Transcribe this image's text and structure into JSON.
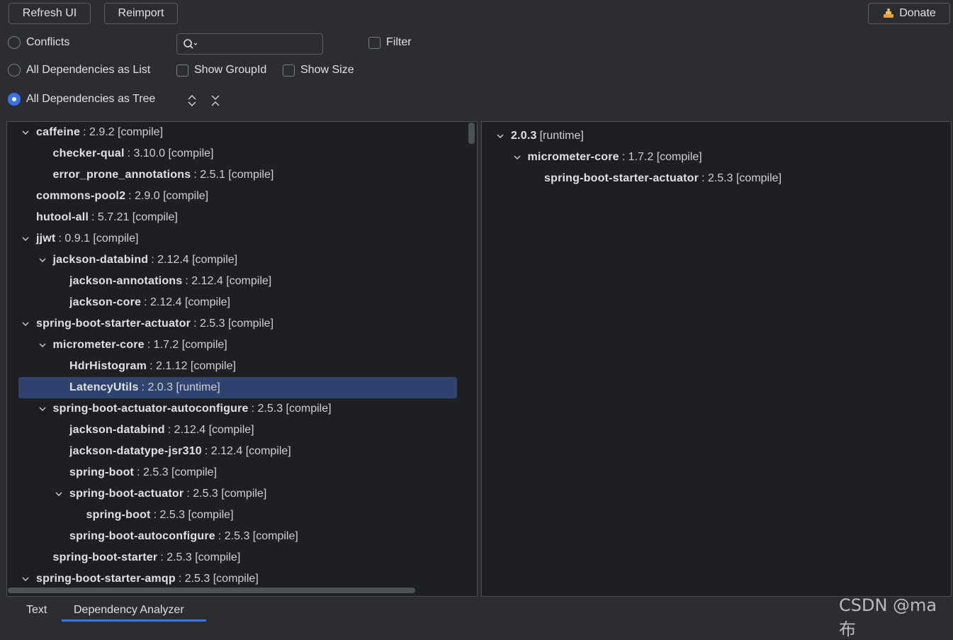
{
  "toolbar": {
    "refresh_label": "Refresh UI",
    "reimport_label": "Reimport",
    "donate_label": "Donate"
  },
  "options": {
    "conflicts_label": "Conflicts",
    "list_label": "All Dependencies as List",
    "tree_label": "All Dependencies as Tree",
    "selected_mode": "tree",
    "filter_label": "Filter",
    "show_groupid_label": "Show GroupId",
    "show_size_label": "Show Size",
    "search_value": "",
    "search_placeholder": ""
  },
  "tree": [
    {
      "name": "caffeine",
      "meta": ": 2.9.2 [compile]",
      "depth": 0,
      "expanded": true
    },
    {
      "name": "checker-qual",
      "meta": ": 3.10.0 [compile]",
      "depth": 1,
      "expanded": null
    },
    {
      "name": "error_prone_annotations",
      "meta": ": 2.5.1 [compile]",
      "depth": 1,
      "expanded": null
    },
    {
      "name": "commons-pool2",
      "meta": ": 2.9.0 [compile]",
      "depth": 0,
      "expanded": null
    },
    {
      "name": "hutool-all",
      "meta": ": 5.7.21 [compile]",
      "depth": 0,
      "expanded": null
    },
    {
      "name": "jjwt",
      "meta": ": 0.9.1 [compile]",
      "depth": 0,
      "expanded": true
    },
    {
      "name": "jackson-databind",
      "meta": ": 2.12.4 [compile]",
      "depth": 1,
      "expanded": true
    },
    {
      "name": "jackson-annotations",
      "meta": ": 2.12.4 [compile]",
      "depth": 2,
      "expanded": null
    },
    {
      "name": "jackson-core",
      "meta": ": 2.12.4 [compile]",
      "depth": 2,
      "expanded": null
    },
    {
      "name": "spring-boot-starter-actuator",
      "meta": ": 2.5.3 [compile]",
      "depth": 0,
      "expanded": true
    },
    {
      "name": "micrometer-core",
      "meta": ": 1.7.2 [compile]",
      "depth": 1,
      "expanded": true
    },
    {
      "name": "HdrHistogram",
      "meta": ": 2.1.12 [compile]",
      "depth": 2,
      "expanded": null
    },
    {
      "name": "LatencyUtils",
      "meta": ": 2.0.3 [runtime]",
      "depth": 2,
      "expanded": null,
      "selected": true
    },
    {
      "name": "spring-boot-actuator-autoconfigure",
      "meta": ": 2.5.3 [compile]",
      "depth": 1,
      "expanded": true
    },
    {
      "name": "jackson-databind",
      "meta": ": 2.12.4 [compile]",
      "depth": 2,
      "expanded": null
    },
    {
      "name": "jackson-datatype-jsr310",
      "meta": ": 2.12.4 [compile]",
      "depth": 2,
      "expanded": null
    },
    {
      "name": "spring-boot",
      "meta": ": 2.5.3 [compile]",
      "depth": 2,
      "expanded": null
    },
    {
      "name": "spring-boot-actuator",
      "meta": ": 2.5.3 [compile]",
      "depth": 2,
      "expanded": true
    },
    {
      "name": "spring-boot",
      "meta": ": 2.5.3 [compile]",
      "depth": 3,
      "expanded": null
    },
    {
      "name": "spring-boot-autoconfigure",
      "meta": ": 2.5.3 [compile]",
      "depth": 2,
      "expanded": null
    },
    {
      "name": "spring-boot-starter",
      "meta": ": 2.5.3 [compile]",
      "depth": 1,
      "expanded": null
    },
    {
      "name": "spring-boot-starter-amqp",
      "meta": ": 2.5.3 [compile]",
      "depth": 0,
      "expanded": true
    }
  ],
  "usages": [
    {
      "name": "2.0.3",
      "meta": "[runtime]",
      "depth": 0,
      "expanded": true
    },
    {
      "name": "micrometer-core",
      "meta": ": 1.7.2 [compile]",
      "depth": 1,
      "expanded": true
    },
    {
      "name": "spring-boot-starter-actuator",
      "meta": ": 2.5.3 [compile]",
      "depth": 2,
      "expanded": null
    }
  ],
  "bottom_tabs": {
    "text_label": "Text",
    "analyzer_label": "Dependency Analyzer",
    "active": "analyzer"
  },
  "watermark": "CSDN @ma布",
  "colors": {
    "background": "#2b2d30",
    "panel": "#1e1f22",
    "accent": "#3574f0",
    "selection": "#2e436e"
  }
}
